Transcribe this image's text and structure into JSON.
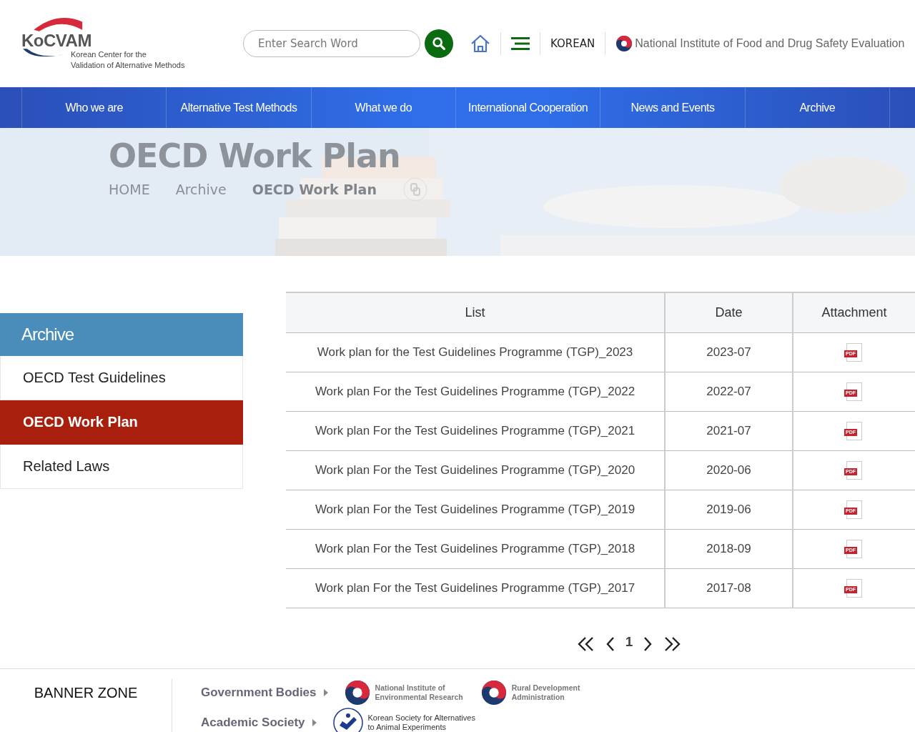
{
  "logo": {
    "name": "KoCVAM",
    "subtitle_lines": [
      "Korean Center for the",
      "Validation of Alternative Methods"
    ]
  },
  "search": {
    "placeholder": "Enter Search Word"
  },
  "header_links": {
    "language": "KOREAN",
    "institute": "National Institute of Food and Drug Safety Evaluation"
  },
  "nav": [
    "Who we are",
    "Alternative Test Methods",
    "What we do",
    "International Cooperation",
    "News and Events",
    "Archive"
  ],
  "hero": {
    "kind": "picture",
    "title": "OECD Work Plan",
    "breadcrumb": [
      "HOME",
      "Archive",
      "OECD Work Plan"
    ]
  },
  "sidebar": {
    "title": "Archive",
    "items": [
      {
        "label": "OECD Test Guidelines",
        "selected": false
      },
      {
        "label": "OECD Work Plan",
        "selected": true
      },
      {
        "label": "Related Laws",
        "selected": false
      }
    ]
  },
  "table": {
    "columns": [
      "List",
      "Date",
      "Attachment"
    ],
    "rows": [
      {
        "title": "Work plan for the Test Guidelines Programme (TGP)_2023",
        "date": "2023-07",
        "attachment": "PDF"
      },
      {
        "title": "Work plan For the Test Guidelines Programme (TGP)_2022",
        "date": "2022-07",
        "attachment": "PDF"
      },
      {
        "title": "Work plan For the Test Guidelines Programme (TGP)_2021",
        "date": "2021-07",
        "attachment": "PDF"
      },
      {
        "title": "Work plan For the Test Guidelines Programme (TGP)_2020",
        "date": "2020-06",
        "attachment": "PDF"
      },
      {
        "title": "Work plan For the Test Guidelines Programme (TGP)_2019",
        "date": "2019-06",
        "attachment": "PDF"
      },
      {
        "title": "Work plan For the Test Guidelines Programme (TGP)_2018",
        "date": "2018-09",
        "attachment": "PDF"
      },
      {
        "title": "Work plan For the Test Guidelines Programme (TGP)_2017",
        "date": "2017-08",
        "attachment": "PDF"
      }
    ]
  },
  "pagination": {
    "pages": [
      {
        "label": "1",
        "selected": true
      }
    ]
  },
  "banner_zone": {
    "title": "BANNER ZONE",
    "groups": [
      {
        "label": "Government Bodies",
        "banners": [
          {
            "kind": "emblem",
            "lines": [
              "National Institute of",
              "Environmental Research"
            ]
          },
          {
            "kind": "emblem",
            "lines": [
              "Rural Development",
              "Administration"
            ]
          }
        ]
      },
      {
        "label": "Academic Society",
        "banners": [
          {
            "kind": "seal",
            "lines": [
              "Korean Society for Alternatives",
              "to Animal Experiments"
            ]
          }
        ]
      }
    ]
  }
}
